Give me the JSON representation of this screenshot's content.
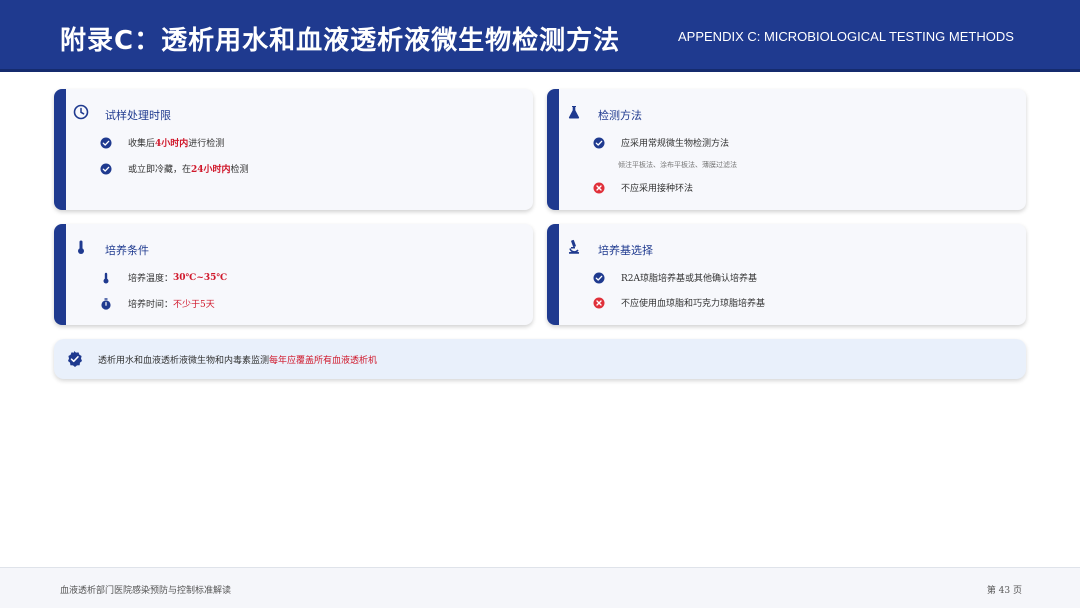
{
  "header": {
    "title": "附录C：透析用水和血液透析液微生物检测方法",
    "subtitle": "APPENDIX C: MICROBIOLOGICAL TESTING METHODS"
  },
  "colors": {
    "primary": "#1f3a8f",
    "highlight": "#d0182b",
    "error": "#e0303a",
    "card_bg": "#f7f8fc",
    "note_bg": "#e9f0fb"
  },
  "cards": {
    "sample": {
      "icon": "clock-icon",
      "title": "试样处理时限",
      "rows": [
        {
          "icon": "check-circle-icon",
          "pre": "收集后",
          "hl": "4小时内",
          "post": "进行检测"
        },
        {
          "icon": "check-circle-icon",
          "pre": "或立即冷藏，在",
          "hl": "24小时内",
          "post": "检测"
        }
      ]
    },
    "method": {
      "icon": "flask-icon",
      "title": "检测方法",
      "rows": [
        {
          "icon": "check-circle-icon",
          "text": "应采用常规微生物检测方法"
        },
        {
          "icon": "x-circle-icon",
          "text": "不应采用接种环法"
        }
      ],
      "note": "倾注平板法、涂布平板法、薄膜过滤法"
    },
    "culture": {
      "icon": "thermometer-icon",
      "title": "培养条件",
      "rows": [
        {
          "icon": "thermometer-icon",
          "pre": "培养温度：",
          "hl": "30℃~35℃",
          "post": ""
        },
        {
          "icon": "stopwatch-icon",
          "pre": "培养时间：",
          "hl": "不少于5天",
          "post": ""
        }
      ]
    },
    "medium": {
      "icon": "microscope-icon",
      "title": "培养基选择",
      "rows": [
        {
          "icon": "check-circle-icon",
          "text": "R2A琼脂培养基或其他确认培养基"
        },
        {
          "icon": "x-circle-icon",
          "text": "不应使用血琼脂和巧克力琼脂培养基"
        }
      ]
    }
  },
  "bottom_note": {
    "icon": "badge-check-icon",
    "pre": "透析用水和血液透析液微生物和内毒素监测",
    "hl": "每年应覆盖所有血液透析机"
  },
  "footer": {
    "left": "血液透析部门医院感染预防与控制标准解读",
    "right": "第 43 页"
  }
}
